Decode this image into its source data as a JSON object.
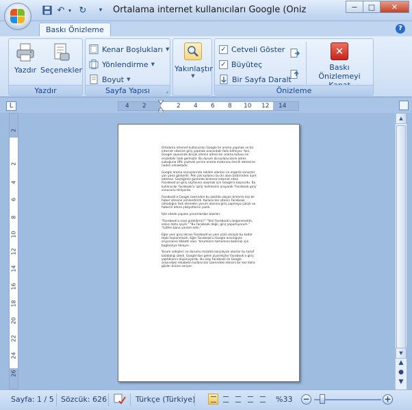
{
  "window": {
    "title": "Ortalama internet kullanıcıları Google (Önizleme) - Micr",
    "min_glyph": "−",
    "max_glyph": "□",
    "close_glyph": "✕"
  },
  "quick_access": {
    "undo_glyph": "↶",
    "redo_glyph": "↻",
    "more_glyph": "▾"
  },
  "tabs": {
    "active": "Baskı Önizleme",
    "help_glyph": "?"
  },
  "ribbon": {
    "groups": [
      {
        "label": "Yazdır",
        "buttons": [
          "Yazdır",
          "Seçenekler"
        ]
      },
      {
        "label": "Sayfa Yapısı",
        "buttons": [
          "Kenar Boşlukları",
          "Yönlendirme",
          "Boyut"
        ]
      },
      {
        "label": "",
        "buttons": [
          "Yakınlaştır"
        ]
      },
      {
        "label": "Önizleme",
        "checks": [
          {
            "label": "Cetveli Göster",
            "checked": true
          },
          {
            "label": "Büyüteç",
            "checked": true
          }
        ],
        "buttons": [
          "Bir Sayfa Daralt",
          "Baskı Önizlemeyi Kapat"
        ]
      }
    ]
  },
  "ruler": {
    "corner_glyph": "L",
    "h_ticks": [
      "4",
      "2",
      "2",
      "4",
      "6",
      "8",
      "10",
      "12",
      "14"
    ],
    "v_ticks": [
      "2",
      "2",
      "4",
      "6",
      "8",
      "10",
      "12",
      "14",
      "16",
      "18",
      "20",
      "22",
      "24",
      "26"
    ]
  },
  "document": {
    "paragraphs": [
      "Ortalama internet kullanıcıları Google ile arama yapmak ve bir internet sitesine giriş yapmak arasındaki farkı bilmiyor. Yani, Google sayesinde birçok sitenin adresi bir arama kutusu ile erişilebilir hale gelmiştir. Bu durum da kullanıcıların adres çubuğuna URL yazmak yerine arama motorunu tercih etmesine neden olmaktadır.",
      "Google arama sonuçlarında reklam alanları ve organik sonuçlar yan yana gösterilir. Pek çok kullanıcı bu iki alanı birbirinden ayırt edemez. Geçtiğimiz günlerde binlerce internet sitesi Facebook'un giriş sayfasına ulaşmak için Google'a başvurdu. Bu kullanıcılar Facebook'a 'giriş' kelimesini arayarak 'Facebook giriş' sonucunu tıklıyordu.",
      "Facebook'a Google üzerinden bu şekilde ulaşan binlerce kişi bir haber sitesine yönlendirildi. Kullanıcılar sitenin Facebook olmadığını fark etmeden yorum alanına giriş yapmaya çalıştı ve haberin altına şikâyetlerini yazdı.",
      "İşte sitede yapılan yorumlardan bazıları:",
      "\"Facebook'a nasıl girebilirim?\" \"Yeni Facebook'u beğenmedim, eskisi daha iyiydi.\" \"Bu Facebook değil, giriş yapamıyorum.\" \"Lütfen bana yardım edin.\"",
      "Eğer yeni giriş ekranı Facebook'un yeni yüzü olsaydı bu kadar tepki toplanmazdı. Eğer Facebook'u Google aracılığıyla arıyorsanız dikkatli olun. Yorumların tamamına bakmak için bağlantıya tıklayın.",
      "Yorum sahipleri ve durumu mizahla karşılayan okurlar bu tuhaf kalabalığı izledi. Google'dan gelen ziyaretçiler Facebook'a giriş yaptıklarını düşünüyordu. Bu olay Facebook ile Google arasındaki rekabetin kullanıcılar üzerindeki etkisini bir kez daha gözler önüne seriyor."
    ]
  },
  "statusbar": {
    "page": "Sayfa: 1 / 5",
    "words": "Sözcük: 626",
    "language": "Türkçe (Türkiye)",
    "zoom": "%33",
    "zoom_minus": "−",
    "zoom_plus": "+"
  }
}
